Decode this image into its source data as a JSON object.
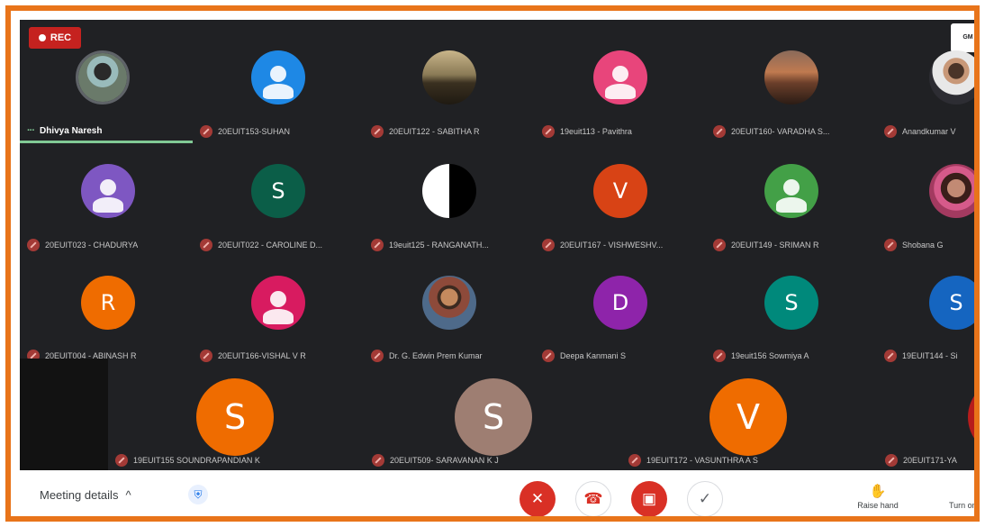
{
  "recording": {
    "label": "REC"
  },
  "corner_button": {
    "label": "GM"
  },
  "participants_row1": [
    {
      "name": "Dhivya Naresh",
      "self": true
    },
    {
      "name": "20EUIT153-SUHAN"
    },
    {
      "name": "20EUIT122 - SABITHA R"
    },
    {
      "name": "19euit113 - Pavithra"
    },
    {
      "name": "20EUIT160- VARADHA S..."
    },
    {
      "name": "Anandkumar V"
    }
  ],
  "participants_row2": [
    {
      "name": "20EUIT023 - CHADURYA"
    },
    {
      "name": "20EUIT022 - CAROLINE D..."
    },
    {
      "name": "19euit125 - RANGANATH..."
    },
    {
      "name": "20EUIT167 - VISHWESHV..."
    },
    {
      "name": "20EUIT149 - SRIMAN R"
    },
    {
      "name": "Shobana G"
    }
  ],
  "participants_row3": [
    {
      "name": "20EUIT004 - ABINASH R",
      "initial": "R"
    },
    {
      "name": "20EUIT166-VISHAL V R"
    },
    {
      "name": "Dr. G. Edwin Prem Kumar"
    },
    {
      "name": "Deepa Kanmani S",
      "initial": "D"
    },
    {
      "name": "19euit156 Sowmiya A",
      "initial": "S"
    },
    {
      "name": "19EUIT144 - Si",
      "initial": "S"
    }
  ],
  "participants_row4": [
    {
      "name": "19EUIT155 SOUNDRAPANDIAN K",
      "initial": "S"
    },
    {
      "name": "20EUIT509- SARAVANAN K J",
      "initial": "S"
    },
    {
      "name": "19EUIT172 - VASUNTHRA A S",
      "initial": "V"
    },
    {
      "name": "20EUIT171-YA"
    }
  ],
  "row2_initials": {
    "caroline": "S",
    "vishwesh": "V"
  },
  "toolbar": {
    "meeting_details": "Meeting details",
    "chevron": "^",
    "raise_hand": "Raise hand",
    "turn_on": "Turn on"
  },
  "colors": {
    "frame": "#e8741a",
    "stage": "#202124",
    "end_call": "#d93025",
    "active_speaker": "#81c995"
  }
}
